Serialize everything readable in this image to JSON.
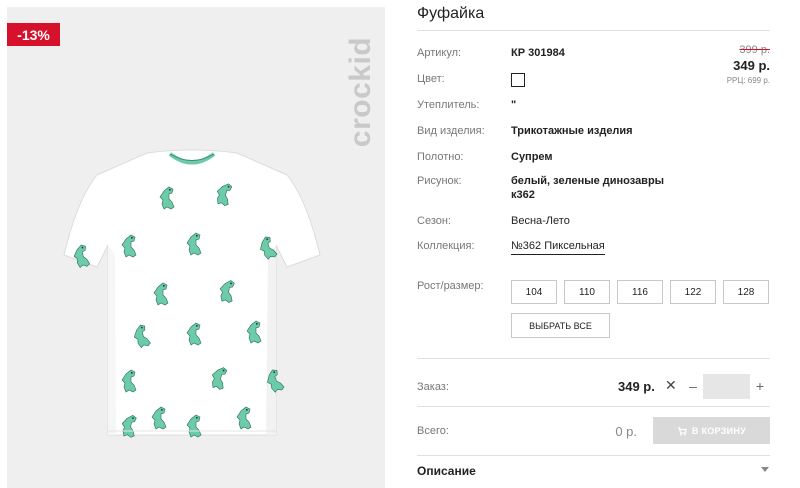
{
  "badge": "-13%",
  "brand": "crockid",
  "title": "Фуфайка",
  "attributes": {
    "article_label": "Артикул:",
    "article_value": "КР 301984",
    "color_label": "Цвет:",
    "color_swatch": "#ffffff",
    "filler_label": "Утеплитель:",
    "filler_value": "\"",
    "type_label": "Вид изделия:",
    "type_value": "Трикотажные изделия",
    "fabric_label": "Полотно:",
    "fabric_value": "Супрем",
    "pattern_label": "Рисунок:",
    "pattern_line1": "белый, зеленые динозавры",
    "pattern_line2": "к362",
    "season_label": "Сезон:",
    "season_value": "Весна-Лето",
    "collection_label": "Коллекция:",
    "collection_value": "№362 Пиксельная"
  },
  "pricing": {
    "old_price": "399 р.",
    "price": "349 р.",
    "rrp": "РРЦ: 699 р."
  },
  "sizes": {
    "label": "Рост/размер:",
    "options": [
      "104",
      "110",
      "116",
      "122",
      "128"
    ],
    "select_all": "ВЫБРАТЬ ВСЕ"
  },
  "order": {
    "label": "Заказ:",
    "price": "349 р.",
    "times": "✕",
    "minus": "–",
    "quantity": "",
    "plus": "+"
  },
  "total": {
    "label": "Всего:",
    "value": "0 р.",
    "cart_button": "В КОРЗИНУ"
  },
  "description": {
    "title": "Описание"
  },
  "colors": {
    "accent": "#d6112b",
    "shirt": "#ffffff",
    "dino": "#6ccba8",
    "dino_dark": "#2a6b56"
  },
  "icons": {
    "cart": "cart-icon",
    "chevron": "chevron-down-icon"
  }
}
